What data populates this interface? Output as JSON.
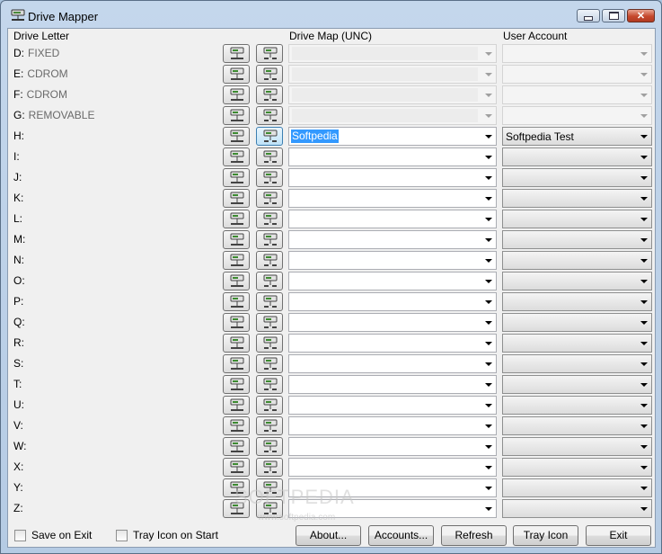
{
  "window": {
    "title": "Drive Mapper"
  },
  "headers": {
    "drive_letter": "Drive Letter",
    "drive_map": "Drive Map (UNC)",
    "user_account": "User Account"
  },
  "rows": [
    {
      "letter": "D:",
      "type": "FIXED",
      "unc": "",
      "account": "",
      "disabled": true
    },
    {
      "letter": "E:",
      "type": "CDROM",
      "unc": "",
      "account": "",
      "disabled": true
    },
    {
      "letter": "F:",
      "type": "CDROM",
      "unc": "",
      "account": "",
      "disabled": true
    },
    {
      "letter": "G:",
      "type": "REMOVABLE",
      "unc": "",
      "account": "",
      "disabled": true
    },
    {
      "letter": "H:",
      "type": "",
      "unc": "Softpedia",
      "account": "Softpedia Test",
      "disabled": false,
      "selected": true
    },
    {
      "letter": "I:",
      "type": "",
      "unc": "",
      "account": "",
      "disabled": false
    },
    {
      "letter": "J:",
      "type": "",
      "unc": "",
      "account": "",
      "disabled": false
    },
    {
      "letter": "K:",
      "type": "",
      "unc": "",
      "account": "",
      "disabled": false
    },
    {
      "letter": "L:",
      "type": "",
      "unc": "",
      "account": "",
      "disabled": false
    },
    {
      "letter": "M:",
      "type": "",
      "unc": "",
      "account": "",
      "disabled": false
    },
    {
      "letter": "N:",
      "type": "",
      "unc": "",
      "account": "",
      "disabled": false
    },
    {
      "letter": "O:",
      "type": "",
      "unc": "",
      "account": "",
      "disabled": false
    },
    {
      "letter": "P:",
      "type": "",
      "unc": "",
      "account": "",
      "disabled": false
    },
    {
      "letter": "Q:",
      "type": "",
      "unc": "",
      "account": "",
      "disabled": false
    },
    {
      "letter": "R:",
      "type": "",
      "unc": "",
      "account": "",
      "disabled": false
    },
    {
      "letter": "S:",
      "type": "",
      "unc": "",
      "account": "",
      "disabled": false
    },
    {
      "letter": "T:",
      "type": "",
      "unc": "",
      "account": "",
      "disabled": false
    },
    {
      "letter": "U:",
      "type": "",
      "unc": "",
      "account": "",
      "disabled": false
    },
    {
      "letter": "V:",
      "type": "",
      "unc": "",
      "account": "",
      "disabled": false
    },
    {
      "letter": "W:",
      "type": "",
      "unc": "",
      "account": "",
      "disabled": false
    },
    {
      "letter": "X:",
      "type": "",
      "unc": "",
      "account": "",
      "disabled": false
    },
    {
      "letter": "Y:",
      "type": "",
      "unc": "",
      "account": "",
      "disabled": false
    },
    {
      "letter": "Z:",
      "type": "",
      "unc": "",
      "account": "",
      "disabled": false
    }
  ],
  "options": {
    "save_on_exit": "Save on Exit",
    "tray_icon_on_start": "Tray Icon on Start"
  },
  "buttons": {
    "about": "About...",
    "accounts": "Accounts...",
    "refresh": "Refresh",
    "tray_icon": "Tray Icon",
    "exit": "Exit"
  },
  "watermark": {
    "brand": "SOFTPEDIA",
    "url": "www.softpedia.com"
  },
  "icons": {
    "app": "network-drive-icon",
    "map": "map-drive-icon",
    "disconnect": "disconnect-drive-icon"
  },
  "colors": {
    "selection": "#3399ff",
    "titlebar": "#b9cee6",
    "close": "#c5482d"
  }
}
